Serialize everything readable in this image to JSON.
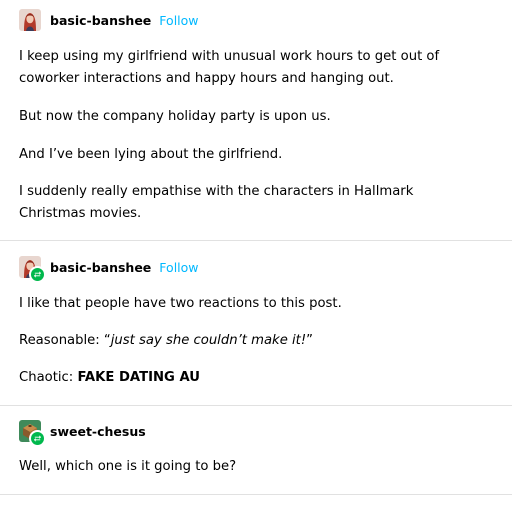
{
  "posts": [
    {
      "username": "basic-banshee",
      "follow_label": "Follow",
      "avatar_icon": "banshee-avatar-icon",
      "paragraphs": [
        "I keep using my girlfriend with unusual work hours to get out of",
        "coworker interactions and happy hours and hanging out.",
        "But now the company holiday party is upon us.",
        "And I’ve been lying about the girlfriend.",
        "I suddenly really empathise with the characters in Hallmark",
        "Christmas movies."
      ]
    },
    {
      "username": "basic-banshee",
      "follow_label": "Follow",
      "avatar_icon": "banshee-avatar-icon",
      "reblog_icon": "reblog-icon",
      "paragraphs": [
        "I like that people have two reactions to this post."
      ],
      "reasonable": {
        "prefix": "Reasonable: “",
        "quote": "just say she couldn’t make it!",
        "suffix": "”"
      },
      "chaotic": {
        "prefix": "Chaotic: ",
        "bold": "FAKE DATING AU"
      }
    },
    {
      "username": "sweet-chesus",
      "avatar_icon": "chesus-avatar-icon",
      "reblog_icon": "reblog-icon",
      "paragraphs": [
        "Well, which one is it going to be?"
      ]
    }
  ],
  "colors": {
    "follow": "#00b8ff",
    "reblog_badge": "#00b84c",
    "divider": "#e1e1e1"
  }
}
